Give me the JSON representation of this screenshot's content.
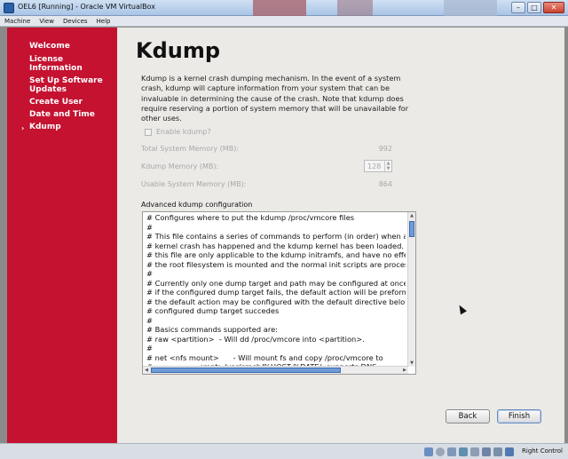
{
  "window": {
    "title": "OEL6 [Running] - Oracle VM VirtualBox",
    "controls": [
      "–",
      "□",
      "✕"
    ]
  },
  "menubar": [
    "Machine",
    "View",
    "Devices",
    "Help"
  ],
  "sidebar": {
    "items": [
      {
        "label": "Welcome"
      },
      {
        "label": "License Information"
      },
      {
        "label": "Set Up Software Updates"
      },
      {
        "label": "Create User"
      },
      {
        "label": "Date and Time"
      },
      {
        "label": "Kdump",
        "active_marker": "›"
      }
    ]
  },
  "main": {
    "heading": "Kdump",
    "description": "Kdump is a kernel crash dumping mechanism. In the event of a system crash, kdump will capture information from your system that can be invaluable in determining the cause of the crash. Note that kdump does require reserving a portion of system memory that will be unavailable for other uses.",
    "enable_label": "Enable kdump?",
    "enable_checked": false,
    "total_label": "Total System Memory (MB):",
    "total_value": "992",
    "kdump_label": "Kdump Memory (MB):",
    "kdump_value": "128",
    "usable_label": "Usable System Memory (MB):",
    "usable_value": "864",
    "advanced_label": "Advanced kdump configuration",
    "config_lines": [
      "# Configures where to put the kdump /proc/vmcore files",
      "#",
      "# This file contains a series of commands to perform (in order) when a",
      "# kernel crash has happened and the kdump kernel has been loaded.  Di",
      "# this file are only applicable to the kdump initramfs, and have no effec",
      "# the root filesystem is mounted and the normal init scripts are proces",
      "#",
      "# Currently only one dump target and path may be configured at once",
      "# if the configured dump target fails, the default action will be preforme",
      "# the default action may be configured with the default directive belov",
      "# configured dump target succedes",
      "#",
      "# Basics commands supported are:",
      "# raw <partition>  - Will dd /proc/vmcore into <partition>.",
      "#",
      "# net <nfs mount>      - Will mount fs and copy /proc/vmcore to",
      "#                   <mnt>/var/crash/%HOST-%DATE/, supports DNS."
    ]
  },
  "buttons": {
    "back": "Back",
    "finish": "Finish"
  },
  "statusbar": {
    "host_key": "Right Control"
  }
}
